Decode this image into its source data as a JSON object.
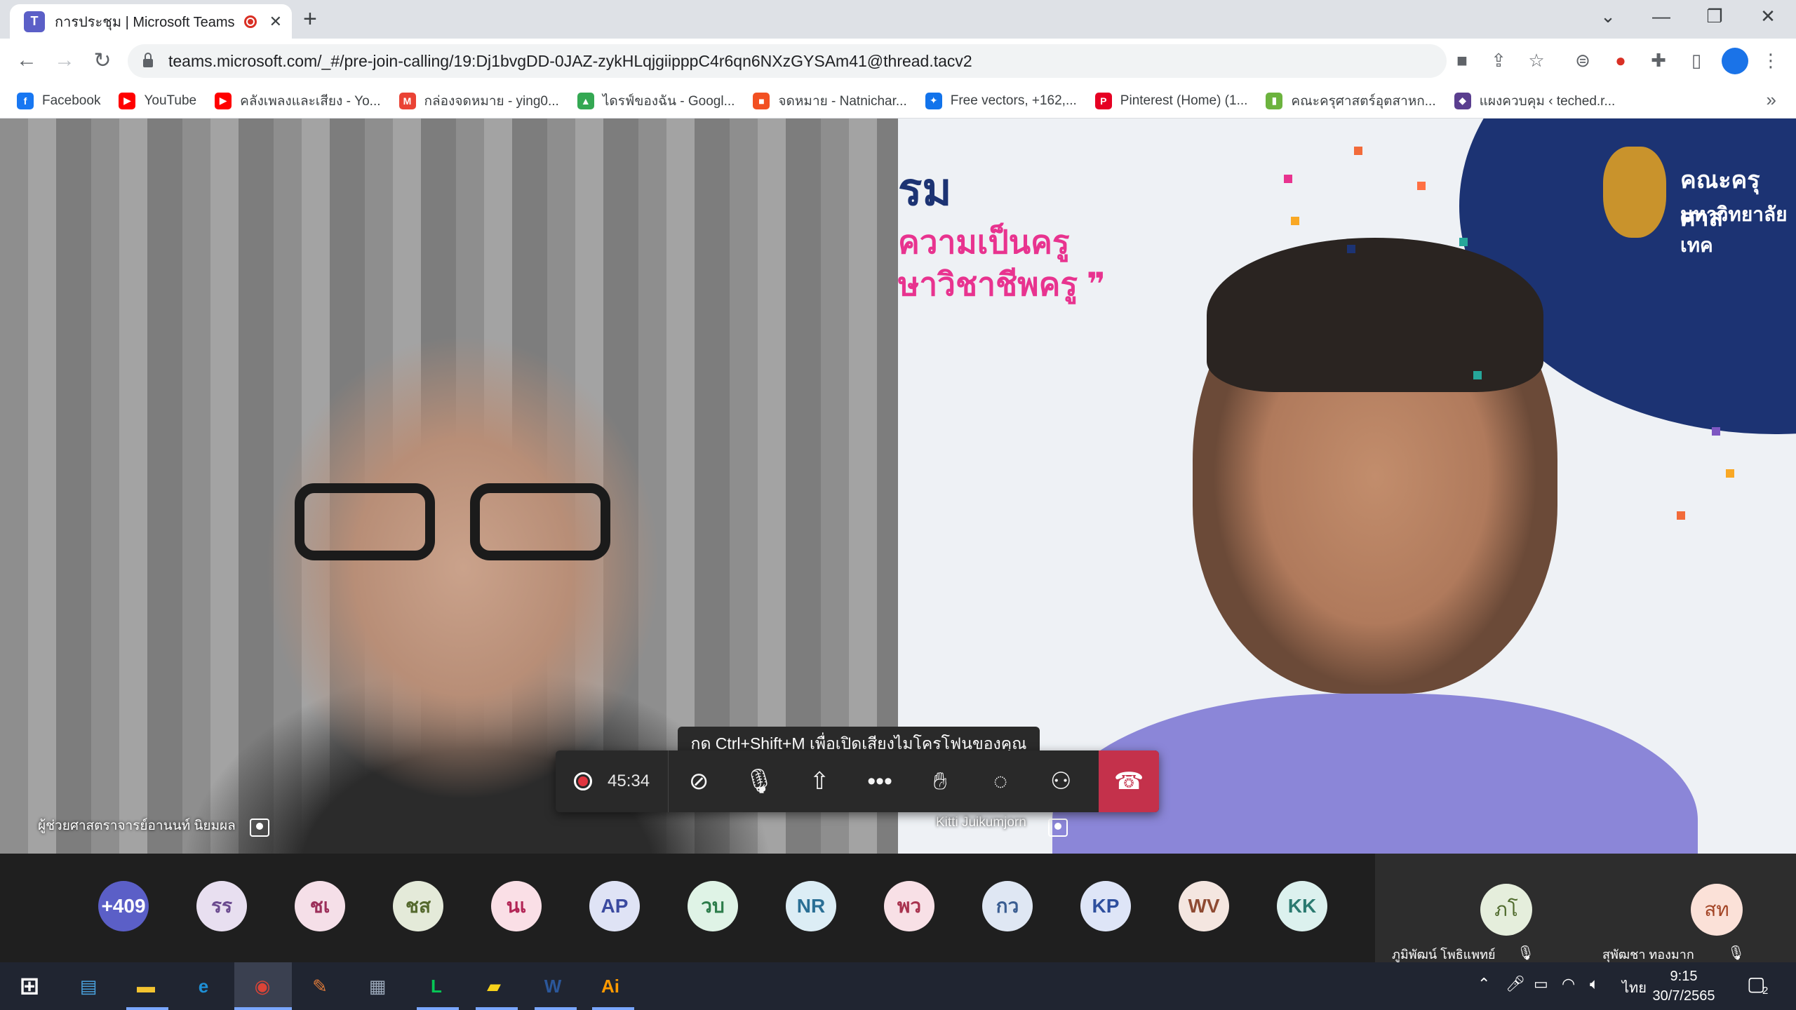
{
  "browser": {
    "tab_title": "การประชุม | Microsoft Teams",
    "url": "teams.microsoft.com/_#/pre-join-calling/19:Dj1bvgDD-0JAZ-zykHLqjgiipppC4r6qn6NXzGYSAm41@thread.tacv2",
    "bookmarks": [
      {
        "label": "Facebook",
        "icon": "facebook-icon",
        "color": "#1877f2",
        "glyph": "f"
      },
      {
        "label": "YouTube",
        "icon": "youtube-icon",
        "color": "#ff0000",
        "glyph": "▶"
      },
      {
        "label": "คลังเพลงและเสียง - Yo...",
        "icon": "youtube-icon",
        "color": "#ff0000",
        "glyph": "▶"
      },
      {
        "label": "กล่องจดหมาย - ying0...",
        "icon": "gmail-icon",
        "color": "#ea4335",
        "glyph": "M"
      },
      {
        "label": "ไดรฟ์ของฉัน - Googl...",
        "icon": "google-drive-icon",
        "color": "#34a853",
        "glyph": "▲"
      },
      {
        "label": "จดหมาย - Natnichar...",
        "icon": "microsoft-icon",
        "color": "#f25022",
        "glyph": "■"
      },
      {
        "label": "Free vectors, +162,...",
        "icon": "freepik-icon",
        "color": "#1273eb",
        "glyph": "✦"
      },
      {
        "label": "Pinterest (Home) (1...",
        "icon": "pinterest-icon",
        "color": "#e60023",
        "glyph": "P"
      },
      {
        "label": "คณะครุศาสตร์อุตสาหก...",
        "icon": "faculty-icon",
        "color": "#6cb33e",
        "glyph": "▮"
      },
      {
        "label": "แผงควบคุม ‹ teched.r...",
        "icon": "dashboard-icon",
        "color": "#5a3e8f",
        "glyph": "◆"
      }
    ]
  },
  "meeting": {
    "left_participant": "ผู้ช่วยศาสตราจารย์อานนท์ นิยมผล",
    "right_participant": "Kitti Juikumjorn",
    "tooltip": "กด Ctrl+Shift+M เพื่อเปิดเสียงไมโครโฟนของคุณ",
    "timer": "45:34",
    "poster": {
      "line1": "รม",
      "line2": "ความเป็นครู",
      "line3": "ษาวิชาชีพครู ❞",
      "org1": "คณะครุศาส",
      "org2": "มหาวิทยาลัยเทค"
    },
    "avatars": [
      {
        "initials": "+409",
        "bg": "#5b5fc7",
        "fg": "#ffffff"
      },
      {
        "initials": "รร",
        "bg": "#e8dff0",
        "fg": "#6b4a8f"
      },
      {
        "initials": "ชเ",
        "bg": "#f5dfe8",
        "fg": "#9c2f5a"
      },
      {
        "initials": "ชส",
        "bg": "#e4ead9",
        "fg": "#55692e"
      },
      {
        "initials": "นเ",
        "bg": "#fadfe6",
        "fg": "#b32556"
      },
      {
        "initials": "AP",
        "bg": "#dfe3f5",
        "fg": "#3b4aa0"
      },
      {
        "initials": "วบ",
        "bg": "#dff3e6",
        "fg": "#2d7d4b"
      },
      {
        "initials": "NR",
        "bg": "#dcedf5",
        "fg": "#2a6f95"
      },
      {
        "initials": "พว",
        "bg": "#f8e0e6",
        "fg": "#a8324e"
      },
      {
        "initials": "กว",
        "bg": "#dfe7f3",
        "fg": "#3a5d91"
      },
      {
        "initials": "KP",
        "bg": "#dee5f7",
        "fg": "#2e4f9e"
      },
      {
        "initials": "WV",
        "bg": "#f4e6e0",
        "fg": "#8e4a32"
      },
      {
        "initials": "KK",
        "bg": "#dcf1ee",
        "fg": "#2b7a70"
      }
    ],
    "featured": [
      {
        "initials": "ภโ",
        "name": "ภูมิพัฒน์ โพธิแพทย์",
        "bg": "#e5eedc",
        "fg": "#4f6a2c"
      },
      {
        "initials": "สท",
        "name": "สุพัฒชา ทองมาก",
        "bg": "#fbe1d8",
        "fg": "#a34526"
      }
    ]
  },
  "taskbar": {
    "time": "9:15",
    "date": "30/7/2565",
    "language": "ไทย",
    "notifications": "2",
    "apps": [
      {
        "name": "start-button",
        "glyph": "⊞",
        "color": "#ffffff"
      },
      {
        "name": "news-app-icon",
        "glyph": "▤",
        "color": "#4aa3df"
      },
      {
        "name": "file-explorer-icon",
        "glyph": "▬",
        "color": "#f4c430"
      },
      {
        "name": "edge-icon",
        "glyph": "e",
        "color": "#1e90d6"
      },
      {
        "name": "chrome-icon",
        "glyph": "◉",
        "color": "#db4437"
      },
      {
        "name": "paint-app-icon",
        "glyph": "✎",
        "color": "#e07b39"
      },
      {
        "name": "scanner-app-icon",
        "glyph": "▦",
        "color": "#9aa7b8"
      },
      {
        "name": "line-icon",
        "glyph": "L",
        "color": "#06c755"
      },
      {
        "name": "sticky-notes-icon",
        "glyph": "▰",
        "color": "#f7d21b"
      },
      {
        "name": "word-icon",
        "glyph": "W",
        "color": "#2b579a"
      },
      {
        "name": "illustrator-icon",
        "glyph": "Ai",
        "color": "#ff9a00"
      }
    ]
  }
}
